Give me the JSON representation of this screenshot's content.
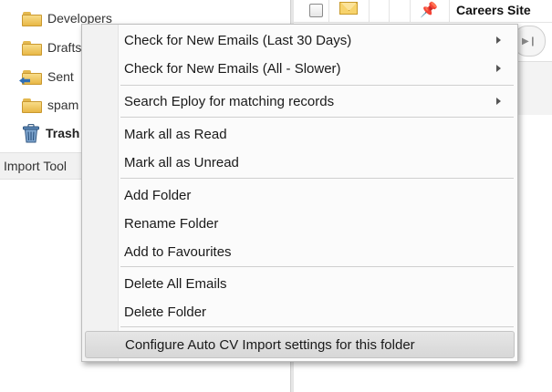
{
  "tree": {
    "items": [
      {
        "label": "Developers",
        "icon": "folder-icon"
      },
      {
        "label": "Drafts",
        "icon": "folder-icon"
      },
      {
        "label": "Sent",
        "icon": "sent-folder-icon"
      },
      {
        "label": "spam",
        "icon": "folder-icon"
      },
      {
        "label": "Trash",
        "icon": "trash-icon"
      }
    ],
    "import_tool": "Import Tool"
  },
  "list": {
    "row": {
      "subject": "Careers Site",
      "pinned": true,
      "unread": true
    }
  },
  "menu": {
    "items": [
      {
        "label": "Check for New Emails (Last 30 Days)",
        "submenu": true
      },
      {
        "label": "Check for New Emails (All - Slower)",
        "submenu": true
      },
      {
        "label": "Search Eploy for matching records",
        "submenu": true
      },
      {
        "label": "Mark all as Read",
        "submenu": false
      },
      {
        "label": "Mark all as Unread",
        "submenu": false
      },
      {
        "label": "Add Folder",
        "submenu": false
      },
      {
        "label": "Rename Folder",
        "submenu": false
      },
      {
        "label": "Add to Favourites",
        "submenu": false
      },
      {
        "label": "Delete All Emails",
        "submenu": false
      },
      {
        "label": "Delete Folder",
        "submenu": false
      },
      {
        "label": "Configure Auto CV Import settings for this folder",
        "submenu": false,
        "highlighted": true
      }
    ]
  },
  "colors": {
    "menu_bg": "#fbfbfb",
    "highlight": "#dcdcdc",
    "folder": "#f0c75e"
  }
}
